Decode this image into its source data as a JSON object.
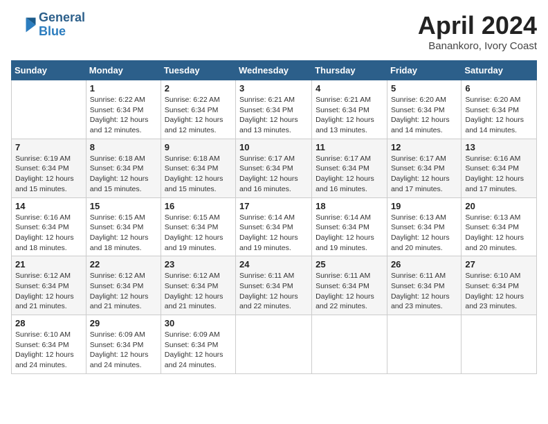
{
  "header": {
    "logo_general": "General",
    "logo_blue": "Blue",
    "month": "April 2024",
    "location": "Banankoro, Ivory Coast"
  },
  "weekdays": [
    "Sunday",
    "Monday",
    "Tuesday",
    "Wednesday",
    "Thursday",
    "Friday",
    "Saturday"
  ],
  "weeks": [
    [
      {
        "day": "",
        "info": ""
      },
      {
        "day": "1",
        "info": "Sunrise: 6:22 AM\nSunset: 6:34 PM\nDaylight: 12 hours\nand 12 minutes."
      },
      {
        "day": "2",
        "info": "Sunrise: 6:22 AM\nSunset: 6:34 PM\nDaylight: 12 hours\nand 12 minutes."
      },
      {
        "day": "3",
        "info": "Sunrise: 6:21 AM\nSunset: 6:34 PM\nDaylight: 12 hours\nand 13 minutes."
      },
      {
        "day": "4",
        "info": "Sunrise: 6:21 AM\nSunset: 6:34 PM\nDaylight: 12 hours\nand 13 minutes."
      },
      {
        "day": "5",
        "info": "Sunrise: 6:20 AM\nSunset: 6:34 PM\nDaylight: 12 hours\nand 14 minutes."
      },
      {
        "day": "6",
        "info": "Sunrise: 6:20 AM\nSunset: 6:34 PM\nDaylight: 12 hours\nand 14 minutes."
      }
    ],
    [
      {
        "day": "7",
        "info": "Sunrise: 6:19 AM\nSunset: 6:34 PM\nDaylight: 12 hours\nand 15 minutes."
      },
      {
        "day": "8",
        "info": "Sunrise: 6:18 AM\nSunset: 6:34 PM\nDaylight: 12 hours\nand 15 minutes."
      },
      {
        "day": "9",
        "info": "Sunrise: 6:18 AM\nSunset: 6:34 PM\nDaylight: 12 hours\nand 15 minutes."
      },
      {
        "day": "10",
        "info": "Sunrise: 6:17 AM\nSunset: 6:34 PM\nDaylight: 12 hours\nand 16 minutes."
      },
      {
        "day": "11",
        "info": "Sunrise: 6:17 AM\nSunset: 6:34 PM\nDaylight: 12 hours\nand 16 minutes."
      },
      {
        "day": "12",
        "info": "Sunrise: 6:17 AM\nSunset: 6:34 PM\nDaylight: 12 hours\nand 17 minutes."
      },
      {
        "day": "13",
        "info": "Sunrise: 6:16 AM\nSunset: 6:34 PM\nDaylight: 12 hours\nand 17 minutes."
      }
    ],
    [
      {
        "day": "14",
        "info": "Sunrise: 6:16 AM\nSunset: 6:34 PM\nDaylight: 12 hours\nand 18 minutes."
      },
      {
        "day": "15",
        "info": "Sunrise: 6:15 AM\nSunset: 6:34 PM\nDaylight: 12 hours\nand 18 minutes."
      },
      {
        "day": "16",
        "info": "Sunrise: 6:15 AM\nSunset: 6:34 PM\nDaylight: 12 hours\nand 19 minutes."
      },
      {
        "day": "17",
        "info": "Sunrise: 6:14 AM\nSunset: 6:34 PM\nDaylight: 12 hours\nand 19 minutes."
      },
      {
        "day": "18",
        "info": "Sunrise: 6:14 AM\nSunset: 6:34 PM\nDaylight: 12 hours\nand 19 minutes."
      },
      {
        "day": "19",
        "info": "Sunrise: 6:13 AM\nSunset: 6:34 PM\nDaylight: 12 hours\nand 20 minutes."
      },
      {
        "day": "20",
        "info": "Sunrise: 6:13 AM\nSunset: 6:34 PM\nDaylight: 12 hours\nand 20 minutes."
      }
    ],
    [
      {
        "day": "21",
        "info": "Sunrise: 6:12 AM\nSunset: 6:34 PM\nDaylight: 12 hours\nand 21 minutes."
      },
      {
        "day": "22",
        "info": "Sunrise: 6:12 AM\nSunset: 6:34 PM\nDaylight: 12 hours\nand 21 minutes."
      },
      {
        "day": "23",
        "info": "Sunrise: 6:12 AM\nSunset: 6:34 PM\nDaylight: 12 hours\nand 21 minutes."
      },
      {
        "day": "24",
        "info": "Sunrise: 6:11 AM\nSunset: 6:34 PM\nDaylight: 12 hours\nand 22 minutes."
      },
      {
        "day": "25",
        "info": "Sunrise: 6:11 AM\nSunset: 6:34 PM\nDaylight: 12 hours\nand 22 minutes."
      },
      {
        "day": "26",
        "info": "Sunrise: 6:11 AM\nSunset: 6:34 PM\nDaylight: 12 hours\nand 23 minutes."
      },
      {
        "day": "27",
        "info": "Sunrise: 6:10 AM\nSunset: 6:34 PM\nDaylight: 12 hours\nand 23 minutes."
      }
    ],
    [
      {
        "day": "28",
        "info": "Sunrise: 6:10 AM\nSunset: 6:34 PM\nDaylight: 12 hours\nand 24 minutes."
      },
      {
        "day": "29",
        "info": "Sunrise: 6:09 AM\nSunset: 6:34 PM\nDaylight: 12 hours\nand 24 minutes."
      },
      {
        "day": "30",
        "info": "Sunrise: 6:09 AM\nSunset: 6:34 PM\nDaylight: 12 hours\nand 24 minutes."
      },
      {
        "day": "",
        "info": ""
      },
      {
        "day": "",
        "info": ""
      },
      {
        "day": "",
        "info": ""
      },
      {
        "day": "",
        "info": ""
      }
    ]
  ]
}
